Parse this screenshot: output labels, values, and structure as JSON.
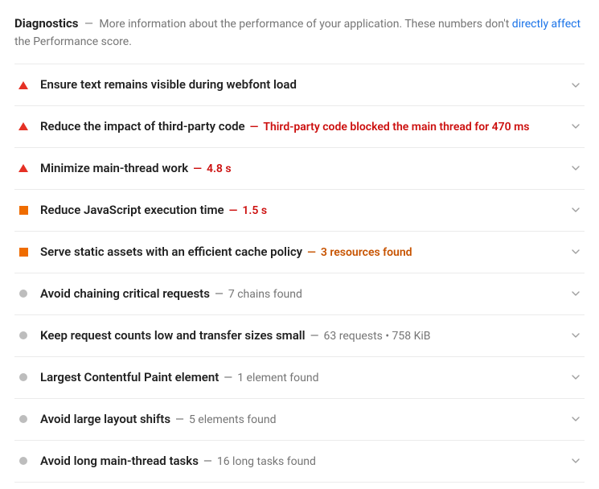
{
  "header": {
    "title": "Diagnostics",
    "dash": "—",
    "desc_before": "More information about the performance of your application. These numbers don't ",
    "link_text": "directly affect",
    "desc_after": " the Performance score."
  },
  "rows": [
    {
      "severity": "red",
      "title": "Ensure text remains visible during webfont load",
      "detail": "",
      "detail_tone": ""
    },
    {
      "severity": "red",
      "title": "Reduce the impact of third-party code",
      "detail": "Third-party code blocked the main thread for 470 ms",
      "detail_tone": "red"
    },
    {
      "severity": "red",
      "title": "Minimize main-thread work",
      "detail": "4.8 s",
      "detail_tone": "red"
    },
    {
      "severity": "orange",
      "title": "Reduce JavaScript execution time",
      "detail": "1.5 s",
      "detail_tone": "red"
    },
    {
      "severity": "orange",
      "title": "Serve static assets with an efficient cache policy",
      "detail": "3 resources found",
      "detail_tone": "orange"
    },
    {
      "severity": "gray",
      "title": "Avoid chaining critical requests",
      "detail": "7 chains found",
      "detail_tone": "gray"
    },
    {
      "severity": "gray",
      "title": "Keep request counts low and transfer sizes small",
      "detail": "63 requests • 758 KiB",
      "detail_tone": "gray"
    },
    {
      "severity": "gray",
      "title": "Largest Contentful Paint element",
      "detail": "1 element found",
      "detail_tone": "gray"
    },
    {
      "severity": "gray",
      "title": "Avoid large layout shifts",
      "detail": "5 elements found",
      "detail_tone": "gray"
    },
    {
      "severity": "gray",
      "title": "Avoid long main-thread tasks",
      "detail": "16 long tasks found",
      "detail_tone": "gray"
    }
  ],
  "dash": "—"
}
